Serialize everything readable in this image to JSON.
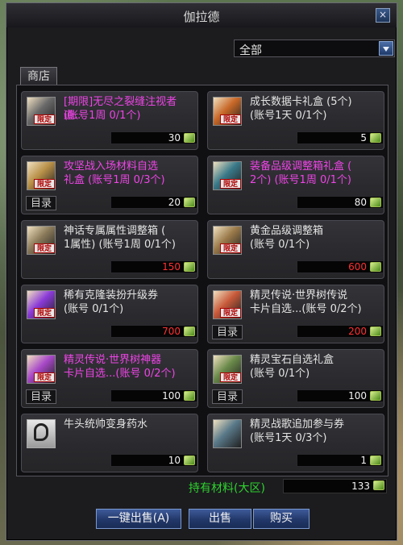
{
  "window": {
    "title": "伽拉德",
    "close_label": "×"
  },
  "filter": {
    "selected": "全部"
  },
  "tab": {
    "label": "商店"
  },
  "items": [
    {
      "name": "[期限]无尽之裂缝注视者道...",
      "line2": "(账号1周 0/1个)",
      "color": "pink",
      "price": "30",
      "price_red": false,
      "badge": "限定",
      "catalog": false,
      "icon": "gear-icon",
      "icon_color": "#6a6a6a"
    },
    {
      "name": "成长数据卡礼盒 (5个)",
      "line2": "(账号1天 0/1个)",
      "color": "white",
      "price": "5",
      "price_red": false,
      "badge": "限定",
      "catalog": false,
      "icon": "gift-icon",
      "icon_color": "#c86828"
    },
    {
      "name": "攻坚战入场材料自选",
      "line2": "礼盒 (账号1周 0/3个)",
      "color": "pink",
      "price": "20",
      "price_red": false,
      "badge": "限定",
      "catalog": true,
      "icon": "box-icon",
      "icon_color": "#b89048"
    },
    {
      "name": "装备品级调整箱礼盒 (",
      "line2": "2个) (账号1周 0/1个)",
      "color": "pink",
      "price": "80",
      "price_red": false,
      "badge": "限定",
      "catalog": false,
      "icon": "chest-icon",
      "icon_color": "#3a7a8a"
    },
    {
      "name": "神话专属属性调整箱 (",
      "line2": "1属性) (账号1周 0/1个)",
      "color": "white",
      "price": "150",
      "price_red": true,
      "badge": "限定",
      "catalog": false,
      "icon": "chest-icon",
      "icon_color": "#8a7a5a"
    },
    {
      "name": "黄金品级调整箱",
      "line2": "(账号 0/1个)",
      "color": "white",
      "price": "600",
      "price_red": true,
      "badge": "限定",
      "catalog": false,
      "icon": "chest-icon",
      "icon_color": "#9a7a4a"
    },
    {
      "name": "稀有克隆装扮升级券",
      "line2": "(账号 0/1个)",
      "color": "white",
      "price": "700",
      "price_red": true,
      "badge": "限定",
      "catalog": false,
      "icon": "ticket-icon",
      "icon_color": "#8a3ad8"
    },
    {
      "name": "精灵传说·世界树传说",
      "line2": "卡片自选...(账号 0/2个)",
      "color": "white",
      "price": "200",
      "price_red": true,
      "badge": "限定",
      "catalog": true,
      "icon": "card-icon",
      "icon_color": "#c85a3a"
    },
    {
      "name": "精灵传说·世界树神器",
      "line2": "卡片自选...(账号 0/2个)",
      "color": "pink",
      "price": "100",
      "price_red": false,
      "badge": "限定",
      "catalog": true,
      "icon": "card-icon",
      "icon_color": "#a848c8"
    },
    {
      "name": "精灵宝石自选礼盒",
      "line2": "(账号 0/1个)",
      "color": "white",
      "price": "100",
      "price_red": false,
      "badge": "限定",
      "catalog": true,
      "icon": "gem-icon",
      "icon_color": "#6a8a4a"
    },
    {
      "name": "牛头统帅变身药水",
      "line2": "",
      "color": "white",
      "price": "10",
      "price_red": false,
      "badge": "",
      "catalog": false,
      "icon": "question-icon",
      "icon_color": "#bbbbbb"
    },
    {
      "name": "精灵战歌追加参与券",
      "line2": "(账号1天 0/3个)",
      "color": "white",
      "price": "1",
      "price_red": false,
      "badge": "",
      "catalog": false,
      "icon": "ticket-icon",
      "icon_color": "#5a7a8a"
    }
  ],
  "catalog_label": "目录",
  "owned": {
    "label": "持有材料(大区)",
    "value": "133"
  },
  "buttons": {
    "sell_all": "一键出售(A)",
    "sell": "出售",
    "buy": "购买"
  },
  "colors": {
    "pink_text": "#ee44e6",
    "price_red": "#ff3030",
    "owned_green": "#2ed22e",
    "button_blue": "#22386a"
  }
}
